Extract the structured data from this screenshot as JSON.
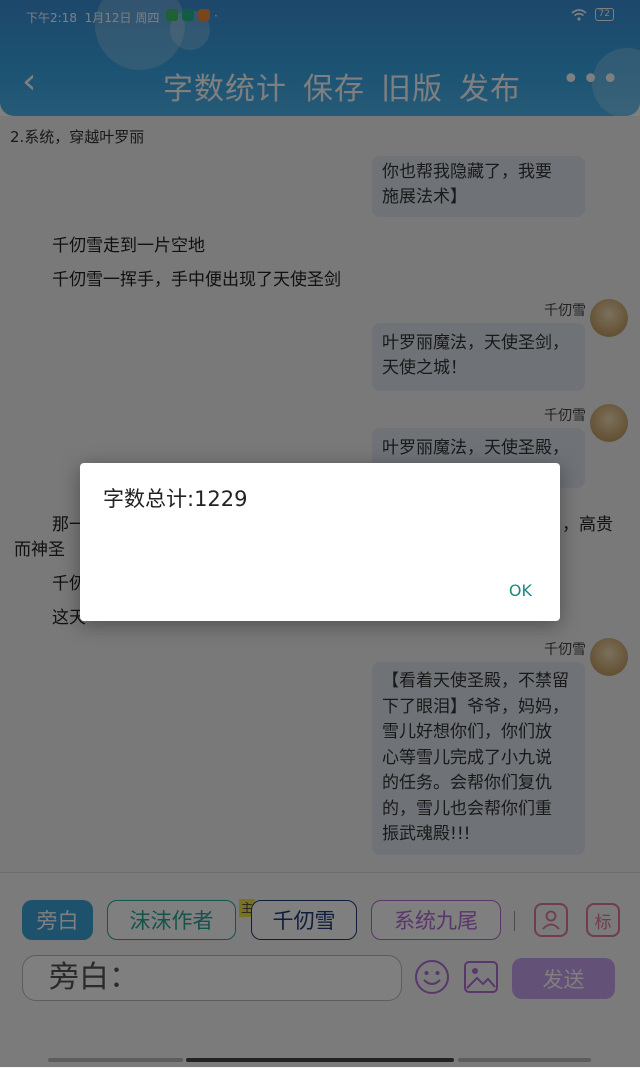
{
  "status_bar": {
    "time": "下午2:18",
    "date": "1月12日 周四",
    "dot": "·",
    "battery": "72"
  },
  "nav": {
    "back_icon": "‹",
    "items": [
      "字数统计",
      "保存",
      "旧版",
      "发布"
    ],
    "more_icon": "•••"
  },
  "chat": {
    "section_title": "2.系统，穿越叶罗丽",
    "messages": [
      {
        "type": "bubble",
        "text_lines": [
          "你也帮我隐藏了，我要",
          "施展法术】"
        ]
      },
      {
        "type": "narration",
        "text": "千仞雪走到一片空地"
      },
      {
        "type": "narration",
        "text": "千仞雪一挥手，手中便出现了天使圣剑"
      },
      {
        "type": "speaker",
        "name": "千仞雪",
        "text_lines": [
          "叶罗丽魔法，天使圣剑，",
          "天使之城！"
        ]
      },
      {
        "type": "speaker",
        "name": "千仞雪",
        "text_lines": [
          "叶罗丽魔法，天使圣殿，"
        ]
      },
      {
        "type": "partial",
        "left_text": "那一",
        "right_text": "，高贵",
        "line2": "而神圣"
      },
      {
        "type": "partial",
        "left_text": "千仞"
      },
      {
        "type": "partial",
        "left_text": "这天"
      },
      {
        "type": "speaker",
        "name": "千仞雪",
        "text_lines": [
          "【看着天使圣殿，不禁留",
          "下了眼泪】爷爷，妈妈，",
          "雪儿好想你们，你们放",
          "心等雪儿完成了小九说",
          "的任务。会帮你们复仇",
          "的，雪儿也会帮你们重",
          "振武魂殿!!!"
        ]
      }
    ]
  },
  "dialog": {
    "title": "字数总计:1229",
    "ok_label": "OK"
  },
  "bottom_bar": {
    "roles": [
      {
        "label": "旁白",
        "style": "filled-blue"
      },
      {
        "label": "沫沫作者",
        "style": "outline-teal"
      },
      {
        "label": "千仞雪",
        "style": "outline-navy",
        "badge": "主"
      },
      {
        "label": "系统九尾",
        "style": "outline-purple"
      }
    ],
    "person_icon": "person-icon",
    "label_button": "标",
    "input_placeholder": "旁白：",
    "send_label": "发送"
  },
  "colors": {
    "header_blue": "#3a9fe0",
    "bubble": "#dfe7f0",
    "ok_teal": "#1a8a80",
    "send_purple": "#c9a3f0"
  }
}
